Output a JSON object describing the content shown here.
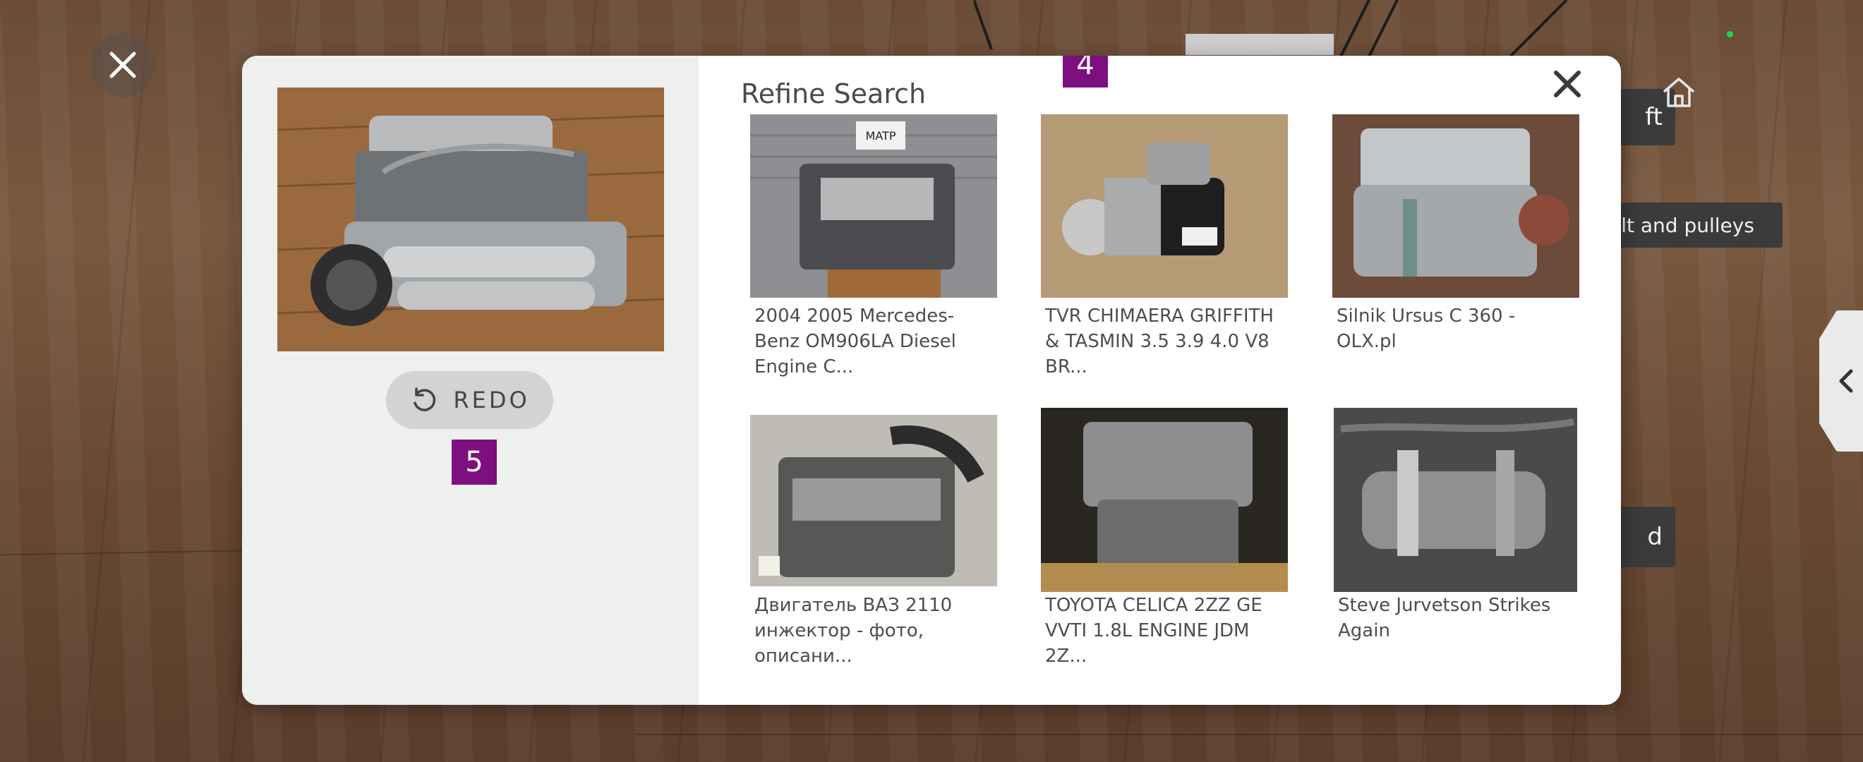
{
  "background": {
    "labels": {
      "label_a": "ft",
      "label_b": "elt and pulleys",
      "label_c": "d"
    }
  },
  "modal": {
    "title": "Refine Search",
    "redo_label": "REDO",
    "markers": {
      "results": "4",
      "redo": "5"
    },
    "results": [
      {
        "caption": "2004 2005 Mercedes-Benz OM906LA Diesel Engine C..."
      },
      {
        "caption": "TVR CHIMAERA GRIFFITH & TASMIN 3.5 3.9 4.0 V8 BR..."
      },
      {
        "caption": "Silnik Ursus C 360 - OLX.pl"
      },
      {
        "caption": "Двигатель ВАЗ 2110 инжектор - фото, описани..."
      },
      {
        "caption": "TOYOTA CELICA 2ZZ GE VVTI 1.8L ENGINE JDM 2Z..."
      },
      {
        "caption": "Steve Jurvetson Strikes Again"
      }
    ],
    "thumbnail_text": "MATP"
  },
  "colors": {
    "marker": "#7e0f80",
    "modal_left": "#eef0ee",
    "redo_button": "#d2d4d3"
  }
}
